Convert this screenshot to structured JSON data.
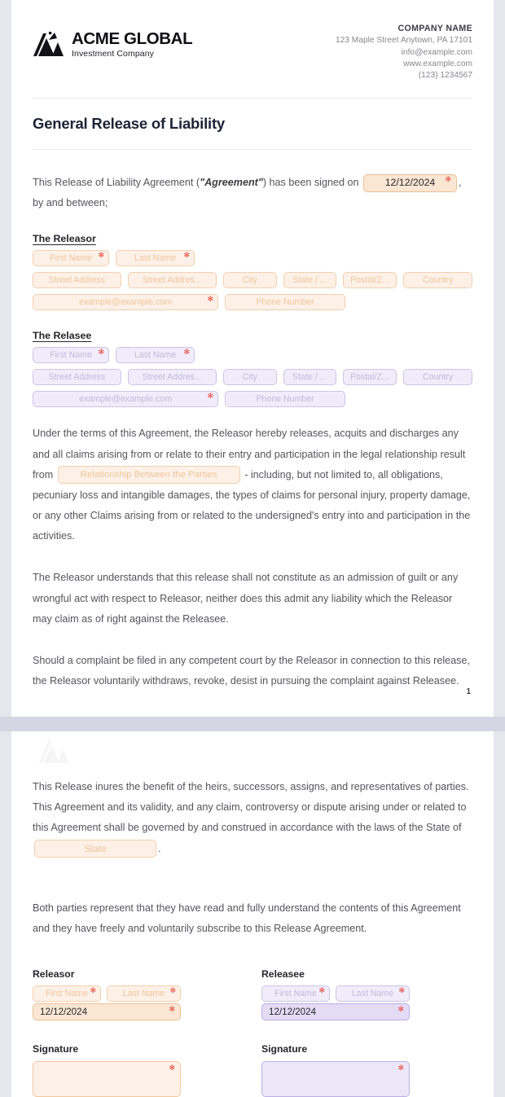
{
  "header": {
    "logo_name": "ACME GLOBAL",
    "logo_sub": "Investment Company",
    "company_name": "COMPANY NAME",
    "company_address": "123 Maple Street Anytown, PA 17101",
    "company_email": "info@example.com",
    "company_web": "www.example.com",
    "company_phone": "(123) 1234567"
  },
  "title": "General Release of Liability",
  "intro": {
    "before": "This Release of Liability Agreement (",
    "emphasis": "\"Agreement\"",
    "middle": ") has been signed on",
    "date_value": "12/12/2024",
    "after": ", by and between;"
  },
  "releasor": {
    "heading": "The Releasor",
    "first_name": "First Name",
    "last_name": "Last Name",
    "street1": "Street Address",
    "street2": "Street Addres...",
    "city": "City",
    "state": "State / ...",
    "postal": "Postal/Z...",
    "country": "Country",
    "email": "example@example.com",
    "phone": "Phone Number"
  },
  "releasee": {
    "heading": "The Relasee",
    "first_name": "First Name",
    "last_name": "Last Name",
    "street1": "Street Address",
    "street2": "Street Addres...",
    "city": "City",
    "state": "State / ...",
    "postal": "Postal/Z...",
    "country": "Country",
    "email": "example@example.com",
    "phone": "Phone Number"
  },
  "terms": {
    "part1": "Under the terms of this Agreement, the Releasor hereby releases, acquits and discharges  any and all claims arising from or relate to their entry and participation in the legal relationship result from",
    "relationship_field": "Relationship Between the Parties",
    "part2": "- including, but not limited to, all obligations, pecuniary loss and intangible damages, the types of claims for personal injury, property damage, or any other Claims arising from or related to the undersigned's entry into and participation in the activities."
  },
  "paragraph_admission": "The Releasor understands that this release shall not constitute as an admission of guilt or any wrongful act with respect to Releasor, neither does this admit any liability which the Releasor may claim as of right against the Releasee.",
  "paragraph_complaint": "Should a complaint be filed in any competent court by the Releasor in connection to this release, the Releasor voluntarily withdraws, revoke, desist in pursuing the complaint against Releasee.",
  "page_number_1": "1",
  "page2": {
    "inures_part1": "This Release inures the benefit of the heirs, successors, assigns, and representatives of parties. This Agreement and its validity, and any claim, controversy or dispute arising under or related to this Agreement shall be governed by and construed in accordance with the laws of the State of",
    "state_field": "State",
    "inures_part2": ".",
    "both_parties": "Both parties represent that they have read and fully understand the contents of this Agreement and they have freely and voluntarily subscribe to this Release Agreement.",
    "releasor_heading": "Releasor",
    "releasee_heading": "Releasee",
    "first_name": "First Name",
    "last_name": "Last Name",
    "date_value": "12/12/2024",
    "signature_label": "Signature"
  },
  "colors": {
    "releasor_accent": "#f3cfae",
    "releasee_accent": "#cdc4e8",
    "required_star": "#e8443a",
    "page_bg": "#e6e6ef",
    "title": "#1d2235"
  },
  "required_marker": "✻"
}
